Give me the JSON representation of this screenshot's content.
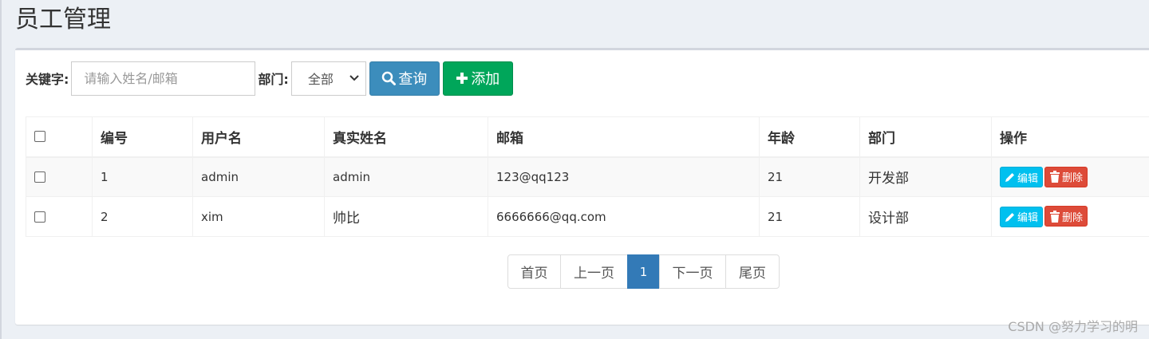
{
  "page": {
    "title": "员工管理"
  },
  "filters": {
    "keyword_label": "关键字:",
    "keyword_placeholder": "请输入姓名/邮箱",
    "dept_label": "部门:",
    "dept_selected": "全部",
    "search_button": "查询",
    "add_button": "添加"
  },
  "table": {
    "headers": [
      "编号",
      "用户名",
      "真实姓名",
      "邮箱",
      "年龄",
      "部门",
      "操作"
    ],
    "rows": [
      {
        "id": "1",
        "username": "admin",
        "realname": "admin",
        "email": "123@qq123",
        "age": "21",
        "dept": "开发部",
        "checked": false
      },
      {
        "id": "2",
        "username": "xim",
        "realname": "帅比",
        "email": "6666666@qq.com",
        "age": "21",
        "dept": "设计部",
        "checked": false
      }
    ],
    "edit_label": "编辑",
    "delete_label": "删除"
  },
  "pagination": {
    "first": "首页",
    "prev": "上一页",
    "current": "1",
    "next": "下一页",
    "last": "尾页"
  },
  "watermark": "CSDN @努力学习的明",
  "colors": {
    "primary": "#3c8dbc",
    "success": "#00a65a",
    "info": "#00c0ef",
    "danger": "#dd4b39",
    "pager_active": "#337ab7"
  },
  "icons": {
    "search": "search-icon",
    "add": "plus-icon",
    "edit": "pencil-icon",
    "delete": "trash-icon",
    "select": "chevron-down-icon"
  }
}
